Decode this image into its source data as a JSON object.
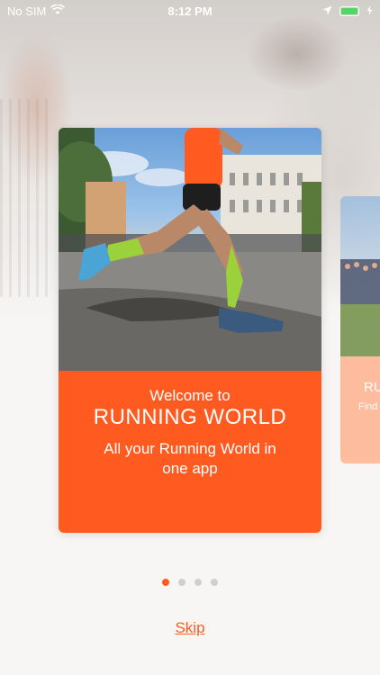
{
  "status_bar": {
    "carrier": "No SIM",
    "time": "8:12 PM",
    "wifi_icon": "wifi-icon",
    "location_icon": "location-arrow-icon",
    "battery_icon": "battery-icon",
    "battery_color": "#4cd964"
  },
  "onboarding": {
    "cards": [
      {
        "welcome": "Welcome to",
        "title": "RUNNING WORLD",
        "subtitle": "All your Running World in one app"
      },
      {
        "title_partial": "RU",
        "subtitle_partial": "Find"
      }
    ],
    "page_count": 4,
    "active_page": 1,
    "skip_label": "Skip"
  },
  "colors": {
    "accent": "#ff5a1f",
    "dot_inactive": "#cfcfcf",
    "background": "#f7f6f5"
  }
}
